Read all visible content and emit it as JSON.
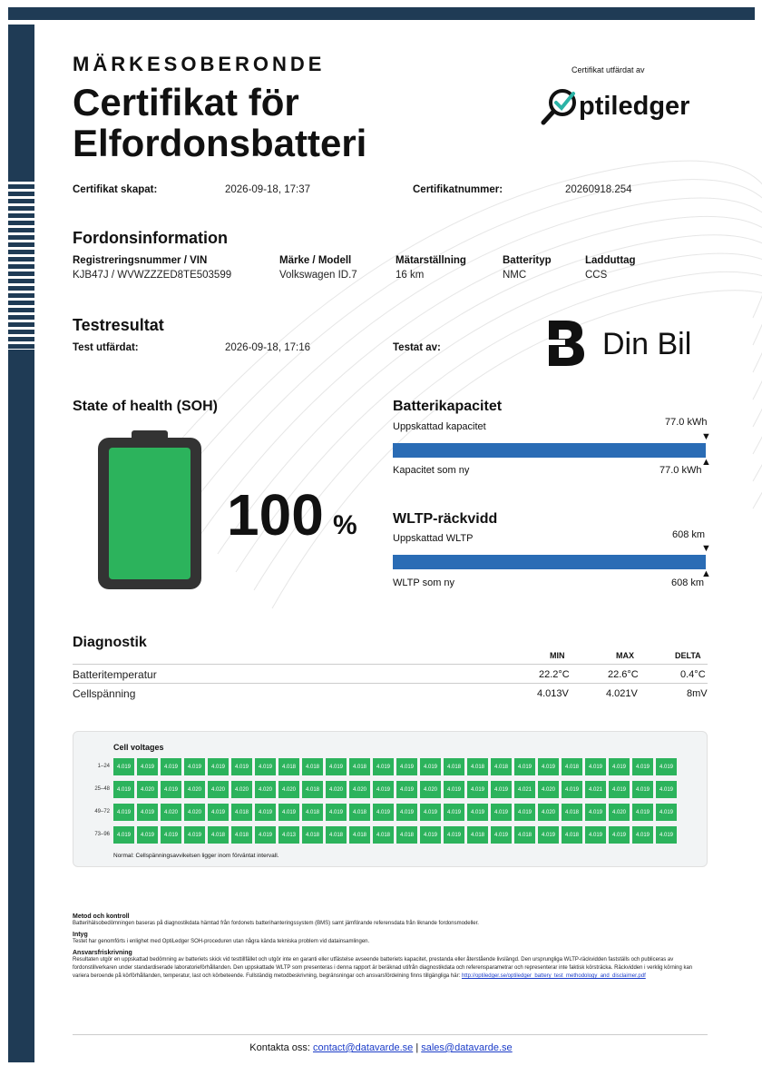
{
  "header": {
    "brand_independent": "MÄRKESOBERONDE",
    "title_line1": "Certifikat för",
    "title_line2": "Elfordonsbatteri",
    "issued_by_label": "Certifikat utfärdat av",
    "issuer_logo_text": "ptiledger"
  },
  "certificate": {
    "created_label": "Certifikat skapat:",
    "created_value": "2026-09-18, 17:37",
    "number_label": "Certifikatnummer:",
    "number_value": "20260918.254"
  },
  "vehicle": {
    "heading": "Fordonsinformation",
    "reg_label": "Registreringsnummer / VIN",
    "reg_value": "KJB47J / WVWZZZED8TE503599",
    "model_label": "Märke / Modell",
    "model_value": "Volkswagen ID.7",
    "odometer_label": "Mätarställning",
    "odometer_value": "16 km",
    "battery_type_label": "Batterityp",
    "battery_type_value": "NMC",
    "charge_port_label": "Ladduttag",
    "charge_port_value": "CCS"
  },
  "test": {
    "heading": "Testresultat",
    "issued_label": "Test utfärdat:",
    "issued_value": "2026-09-18, 17:16",
    "tested_by_label": "Testat av:",
    "tester_name": "Din Bil"
  },
  "soh": {
    "heading": "State of health (SOH)",
    "value": "100",
    "unit": "%",
    "level": 1.0,
    "battery_color": "#2cb35c"
  },
  "capacity": {
    "heading": "Batterikapacitet",
    "estimated_label": "Uppskattad kapacitet",
    "estimated_value": "77.0 kWh",
    "new_label": "Kapacitet som ny",
    "new_value": "77.0 kWh",
    "fill": 1.0,
    "bar_color": "#2a6cb5"
  },
  "wltp": {
    "heading": "WLTP-räckvidd",
    "estimated_label": "Uppskattad WLTP",
    "estimated_value": "608 km",
    "new_label": "WLTP som ny",
    "new_value": "608 km",
    "fill": 1.0
  },
  "diagnostics": {
    "heading": "Diagnostik",
    "col_min": "MIN",
    "col_max": "MAX",
    "col_delta": "DELTA",
    "rows": [
      {
        "name": "Batteritemperatur",
        "min": "22.2°C",
        "max": "22.6°C",
        "delta": "0.4°C"
      },
      {
        "name": "Cellspänning",
        "min": "4.013V",
        "max": "4.021V",
        "delta": "8mV"
      }
    ]
  },
  "cells": {
    "heading": "Cell voltages",
    "row_labels": [
      "1–24",
      "25–48",
      "49–72",
      "73–96"
    ],
    "values": [
      [
        "4.019",
        "4.019",
        "4.019",
        "4.019",
        "4.019",
        "4.019",
        "4.019",
        "4.018",
        "4.018",
        "4.019",
        "4.018",
        "4.019",
        "4.019",
        "4.019",
        "4.018",
        "4.018",
        "4.018",
        "4.019",
        "4.019",
        "4.018",
        "4.019",
        "4.019",
        "4.019",
        "4.019"
      ],
      [
        "4.019",
        "4.020",
        "4.019",
        "4.020",
        "4.020",
        "4.020",
        "4.020",
        "4.020",
        "4.018",
        "4.020",
        "4.020",
        "4.019",
        "4.019",
        "4.020",
        "4.019",
        "4.019",
        "4.019",
        "4.021",
        "4.020",
        "4.019",
        "4.021",
        "4.019",
        "4.019",
        "4.019"
      ],
      [
        "4.019",
        "4.019",
        "4.020",
        "4.020",
        "4.019",
        "4.018",
        "4.019",
        "4.019",
        "4.018",
        "4.019",
        "4.018",
        "4.019",
        "4.019",
        "4.019",
        "4.019",
        "4.019",
        "4.019",
        "4.019",
        "4.020",
        "4.018",
        "4.019",
        "4.020",
        "4.019",
        "4.019"
      ],
      [
        "4.019",
        "4.019",
        "4.019",
        "4.019",
        "4.018",
        "4.018",
        "4.019",
        "4.013",
        "4.018",
        "4.018",
        "4.018",
        "4.018",
        "4.018",
        "4.019",
        "4.019",
        "4.018",
        "4.019",
        "4.018",
        "4.019",
        "4.018",
        "4.019",
        "4.019",
        "4.019",
        "4.019"
      ]
    ],
    "normal_note": "Normal: Cellspänningsavvikelsen ligger inom förväntat intervall.",
    "cell_color": "#2cb35c"
  },
  "footer_text": {
    "method_heading": "Metod och kontroll",
    "method_text": "Batterihälsobedömningen baseras på diagnostikdata hämtad från fordonets batterihanteringssystem (BMS) samt jämförande referensdata från liknande fordonsmodeller.",
    "cert_heading": "Intyg",
    "cert_text": "Testet har genomförts i enlighet med OptiLedger SOH-proceduren utan några kända tekniska problem vid datainsamlingen.",
    "disclaimer_heading": "Ansvarsfriskrivning",
    "disclaimer_text": "Resultaten utgör en uppskattad bedömning av batteriets skick vid testtillfället och utgör inte en garanti eller utfästelse avseende batteriets kapacitet, prestanda eller återstående livslängd. Den ursprungliga WLTP-räckvidden fastställs och publiceras av fordonstillverkaren under standardiserade laboratorieförhållanden. Den uppskattade WLTP som presenteras i denna rapport är beräknad utifrån diagnostikdata och referensparametrar och representerar inte faktisk körsträcka. Räckvidden i verklig körning kan variera beroende på körförhållanden, temperatur, last och körbeteende. Fullständig metodbeskrivning, begränsningar och ansvarsfördelning finns tillgängliga här:",
    "link_text": "http://optiledger.se/optiledger_battery_test_methodology_and_disclaimer.pdf"
  },
  "contact": {
    "label": "Kontakta oss:",
    "email1": "contact@datavarde.se",
    "separator": "|",
    "email2": "sales@datavarde.se"
  }
}
